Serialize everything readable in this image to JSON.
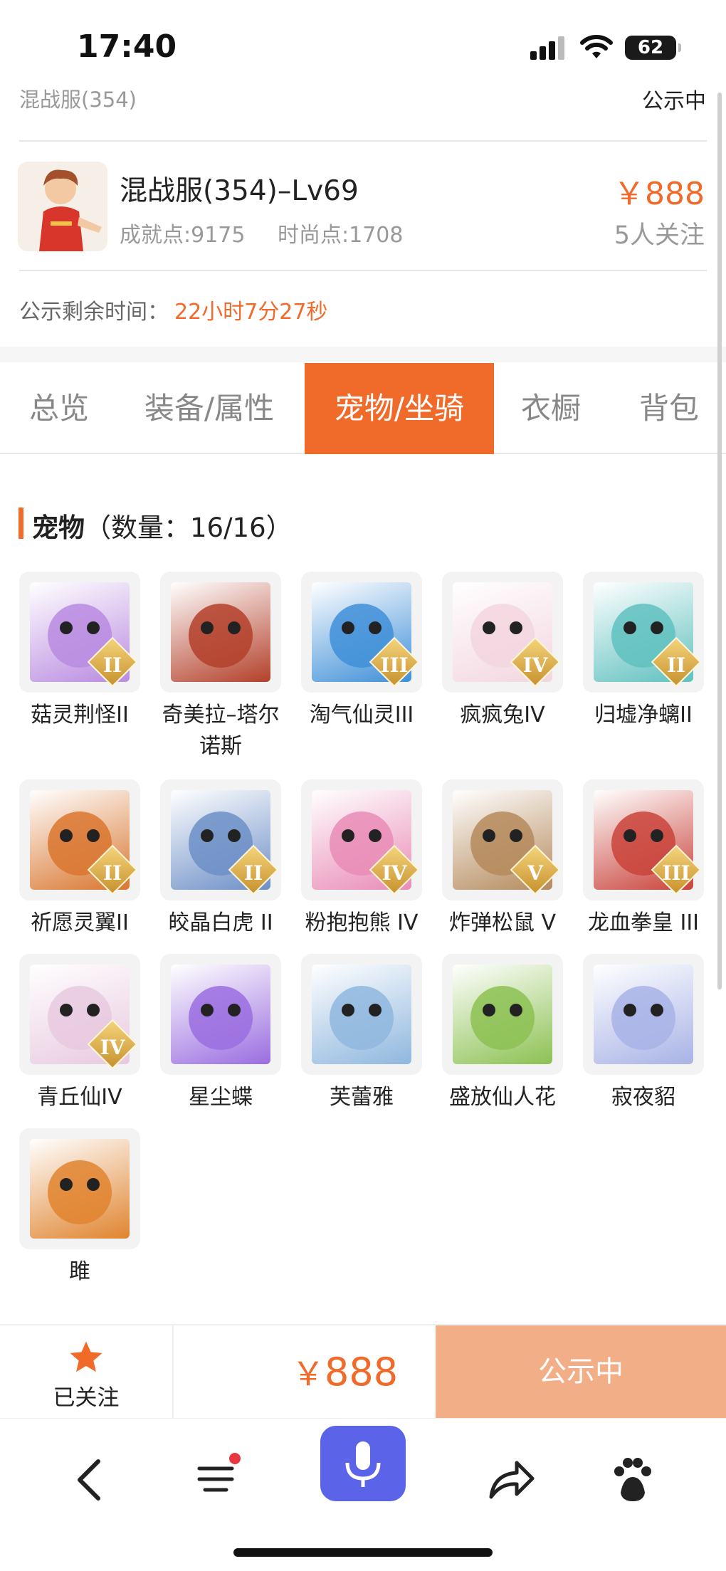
{
  "status_bar": {
    "time": "17:40",
    "battery": "62"
  },
  "header": {
    "server": "混战服(354)",
    "status": "公示中"
  },
  "character": {
    "title": "混战服(354)–Lv69",
    "achievement": "成就点:9175",
    "fashion": "时尚点:1708",
    "price": "￥888",
    "followers": "5人关注"
  },
  "remaining": {
    "label": "公示剩余时间：",
    "value": "22小时7分27秒"
  },
  "tabs": [
    {
      "label": "总览"
    },
    {
      "label": "装备/属性"
    },
    {
      "label": "宠物/坐骑"
    },
    {
      "label": "衣橱"
    },
    {
      "label": "背包"
    }
  ],
  "active_tab": "宠物/坐骑",
  "section": {
    "title": "宠物",
    "count": "（数量：16/16）"
  },
  "pets": [
    {
      "name": "菇灵荆怪II",
      "badge": "II",
      "color": "#b98be0"
    },
    {
      "name": "奇美拉–塔尔诺斯",
      "badge": "",
      "color": "#b3402a"
    },
    {
      "name": "淘气仙灵III",
      "badge": "III",
      "color": "#3f8fd8"
    },
    {
      "name": "疯疯兔IV",
      "badge": "IV",
      "color": "#f3d6df"
    },
    {
      "name": "归墟净螭II",
      "badge": "II",
      "color": "#5fc1bf"
    },
    {
      "name": "祈愿灵翼II",
      "badge": "II",
      "color": "#d9762f"
    },
    {
      "name": "皎晶白虎 II",
      "badge": "II",
      "color": "#6d8fc7"
    },
    {
      "name": "粉抱抱熊 IV",
      "badge": "IV",
      "color": "#e98cb6"
    },
    {
      "name": "炸弹松鼠 V",
      "badge": "V",
      "color": "#b58a5c"
    },
    {
      "name": "龙血拳皇 III",
      "badge": "III",
      "color": "#c9433a"
    },
    {
      "name": "青丘仙IV",
      "badge": "IV",
      "color": "#e8c9df"
    },
    {
      "name": "星尘蝶",
      "badge": "",
      "color": "#9a6de0"
    },
    {
      "name": "芙蕾雅",
      "badge": "",
      "color": "#8fb7de"
    },
    {
      "name": "盛放仙人花",
      "badge": "",
      "color": "#8cc152"
    },
    {
      "name": "寂夜貂",
      "badge": "",
      "color": "#a8b3e6"
    },
    {
      "name": "雎",
      "badge": "",
      "color": "#e0842f"
    }
  ],
  "bottom": {
    "follow_label": "已关注",
    "price": "888",
    "currency": "￥",
    "action": "公示中"
  },
  "colors": {
    "accent": "#f06a2a",
    "mic": "#5b63e8",
    "action_bg": "#f2ae86"
  },
  "icons": [
    "signal-icon",
    "wifi-icon",
    "battery-icon",
    "star-icon",
    "back-icon",
    "menu-icon",
    "mic-icon",
    "share-icon",
    "baidu-icon"
  ]
}
